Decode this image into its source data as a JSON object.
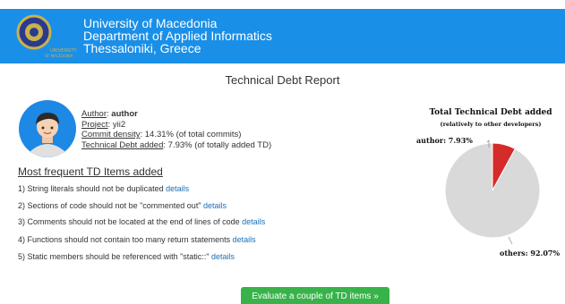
{
  "header": {
    "logo_text": "UNIVERSITY OF MACEDONIA",
    "lines": [
      "University of Macedonia",
      "Department of Applied Informatics",
      "Thessaloniki, Greece"
    ]
  },
  "report": {
    "title": "Technical Debt Report"
  },
  "info": {
    "author_label": "Author",
    "author_value": "author",
    "project_label": "Project",
    "project_value": "yii2",
    "density_label": "Commit density",
    "density_value": "14.31% (of total commits)",
    "td_label": "Technical Debt added",
    "td_value": "7.93% (of totally added TD)"
  },
  "frequent": {
    "title": "Most frequent TD Items added",
    "items": [
      {
        "text": "1) String literals should not be duplicated",
        "link": "details"
      },
      {
        "text": "2) Sections of code should not be \"commented out\"",
        "link": "details"
      },
      {
        "text": "3) Comments should not be located at the end of lines of code",
        "link": "details"
      },
      {
        "text": "4) Functions should not contain too many return statements",
        "link": "details"
      },
      {
        "text": "5) Static members should be referenced with \"static::\"",
        "link": "details"
      }
    ]
  },
  "chart_data": {
    "type": "pie",
    "title": "Total Technical Debt added",
    "subtitle": "(relatively to other developers)",
    "slices": [
      {
        "label": "author",
        "value": 7.93,
        "display": "author: 7.93%",
        "color": "#d62b2b"
      },
      {
        "label": "others",
        "value": 92.07,
        "display": "others: 92.07%",
        "color": "#d9d9d9"
      }
    ]
  },
  "actions": {
    "evaluate_label": "Evaluate a couple of TD items »"
  },
  "colors": {
    "header_bg": "#1a8fe8",
    "button_bg": "#37b34a",
    "link": "#1a6fb6"
  }
}
